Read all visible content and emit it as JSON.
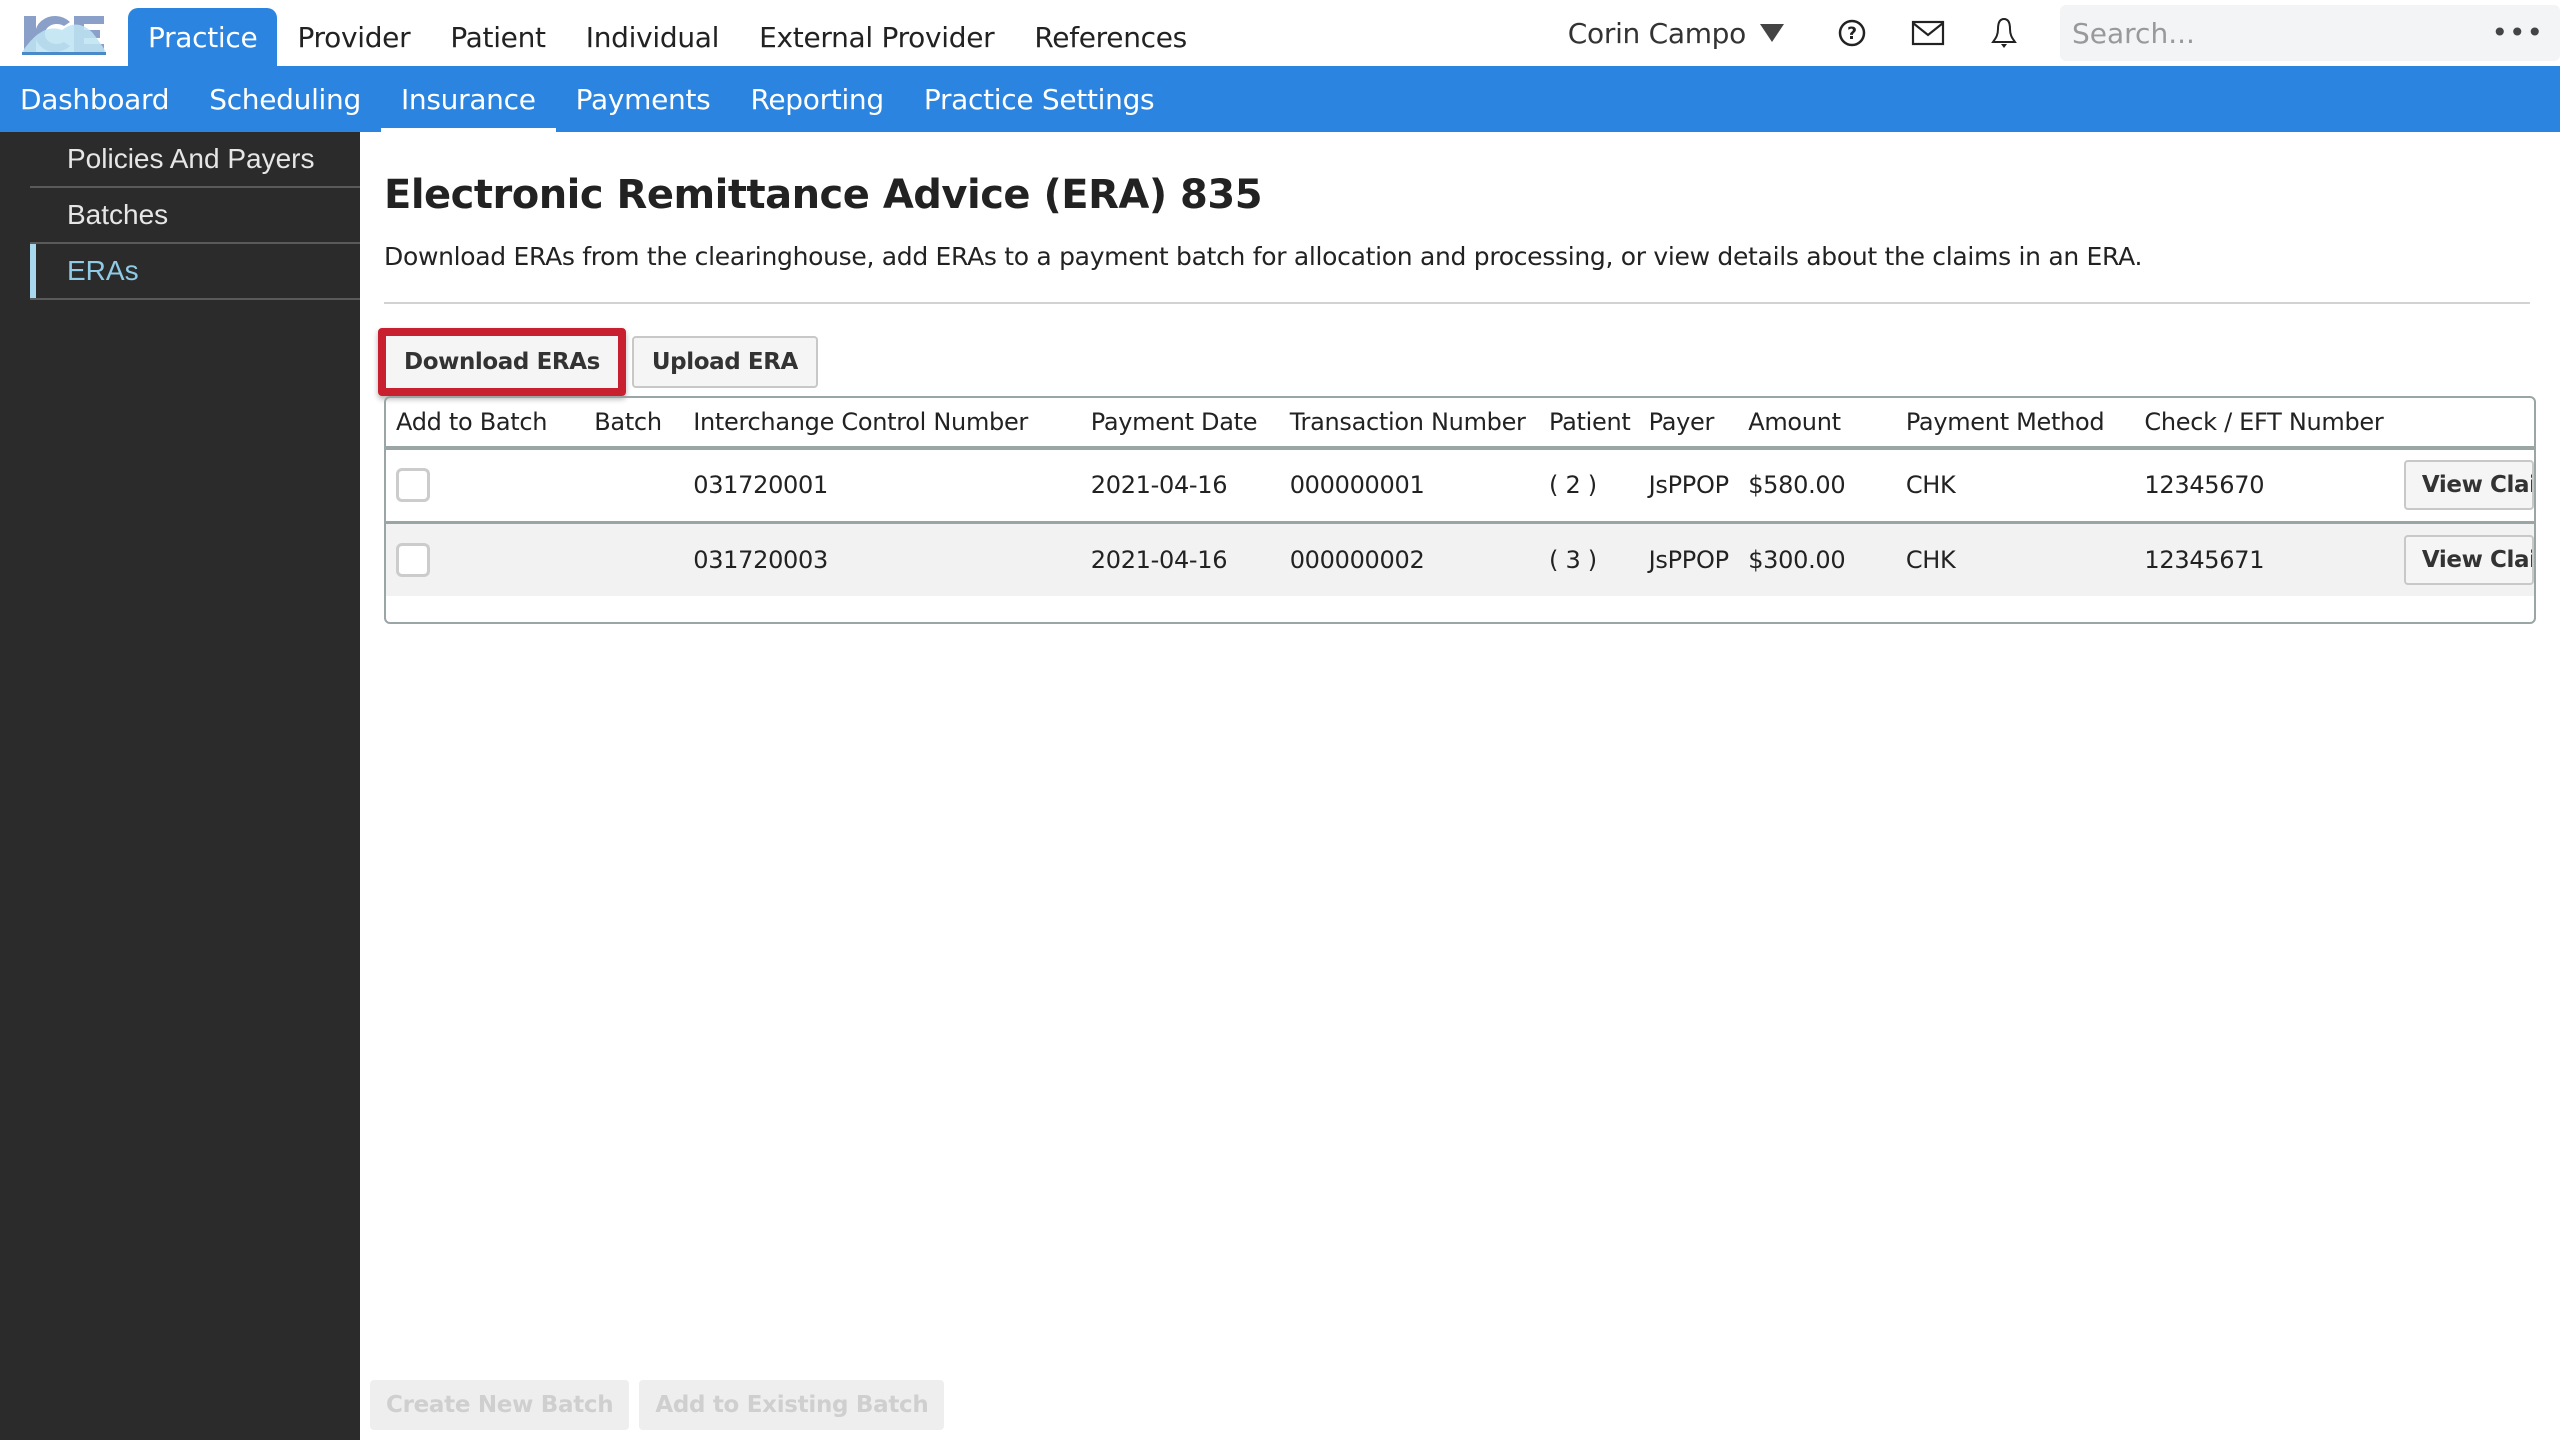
{
  "app": {
    "logo_text": "ICE"
  },
  "top_nav": {
    "tabs": [
      {
        "label": "Practice",
        "active": true
      },
      {
        "label": "Provider",
        "active": false
      },
      {
        "label": "Patient",
        "active": false
      },
      {
        "label": "Individual",
        "active": false
      },
      {
        "label": "External Provider",
        "active": false
      },
      {
        "label": "References",
        "active": false
      }
    ],
    "user_name": "Corin Campo",
    "icons": [
      "help-icon",
      "mail-icon",
      "bell-icon"
    ],
    "search": {
      "value": "",
      "placeholder": "Search..."
    },
    "more_label": "•••"
  },
  "sub_nav": {
    "tabs": [
      {
        "label": "Dashboard",
        "active": false
      },
      {
        "label": "Scheduling",
        "active": false
      },
      {
        "label": "Insurance",
        "active": true
      },
      {
        "label": "Payments",
        "active": false
      },
      {
        "label": "Reporting",
        "active": false
      },
      {
        "label": "Practice Settings",
        "active": false
      }
    ]
  },
  "sidebar": {
    "items": [
      {
        "label": "Policies And Payers",
        "active": false
      },
      {
        "label": "Batches",
        "active": false
      },
      {
        "label": "ERAs",
        "active": true
      }
    ]
  },
  "main": {
    "title": "Electronic Remittance Advice (ERA) 835",
    "description": "Download ERAs from the clearinghouse, add ERAs to a payment batch for allocation and processing, or view details about the claims in an ERA.",
    "actions": {
      "download_label": "Download ERAs",
      "upload_label": "Upload ERA"
    },
    "table": {
      "columns": [
        "Add to Batch",
        "Batch",
        "Interchange Control Number",
        "Payment Date",
        "Transaction Number",
        "Patient",
        "Payer",
        "Amount",
        "Payment Method",
        "Check / EFT Number",
        ""
      ],
      "rows": [
        {
          "checked": false,
          "batch": "",
          "icn": "031720001",
          "payment_date": "2021-04-16",
          "transaction": "000000001",
          "patient": "( 2 )",
          "payer": "JsPPOP",
          "amount": "$580.00",
          "method": "CHK",
          "check_number": "12345670",
          "action_label": "View Claims"
        },
        {
          "checked": false,
          "batch": "",
          "icn": "031720003",
          "payment_date": "2021-04-16",
          "transaction": "000000002",
          "patient": "( 3 )",
          "payer": "JsPPOP",
          "amount": "$300.00",
          "method": "CHK",
          "check_number": "12345671",
          "action_label": "View Claims"
        }
      ]
    },
    "footer": {
      "create_batch_label": "Create New Batch",
      "add_existing_label": "Add to Existing Batch"
    }
  },
  "colors": {
    "brand_blue": "#2a84e0",
    "sidebar_bg": "#2b2b2b",
    "sidebar_active": "#8fcbe6",
    "highlight_red": "#c8202f"
  }
}
